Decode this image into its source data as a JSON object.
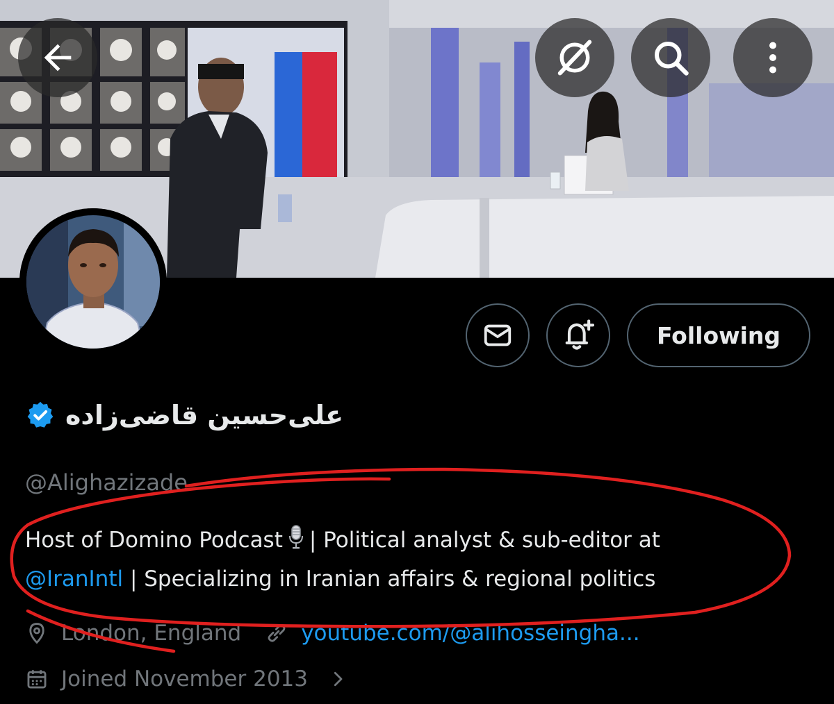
{
  "profile": {
    "display_name": "علی‌حسین قاضی‌زاده",
    "handle": "@Alighazizade",
    "bio": {
      "part1": "Host of Domino Podcast",
      "part2": "| Political analyst & sub-editor at",
      "mention": "@IranIntl",
      "part3": "| Specializing in Iranian affairs & regional politics"
    },
    "location": "London, England",
    "website": "youtube.com/@alihosseingha...",
    "joined": "Joined November 2013",
    "verified": true
  },
  "actions": {
    "follow_label": "Following"
  },
  "icons": {
    "back": "back-arrow-icon",
    "grok": "grok-icon",
    "search": "search-icon",
    "more": "more-vertical-icon",
    "message": "envelope-icon",
    "notify": "bell-plus-icon",
    "verified": "verified-badge-icon",
    "location": "location-pin-icon",
    "link": "link-icon",
    "calendar": "calendar-icon",
    "chevron": "chevron-right-icon",
    "mic": "microphone-icon"
  },
  "colors": {
    "background": "#000000",
    "text": "#e7e9ea",
    "muted": "#71767b",
    "link": "#1d9bf0",
    "annotation": "#e0201f"
  }
}
